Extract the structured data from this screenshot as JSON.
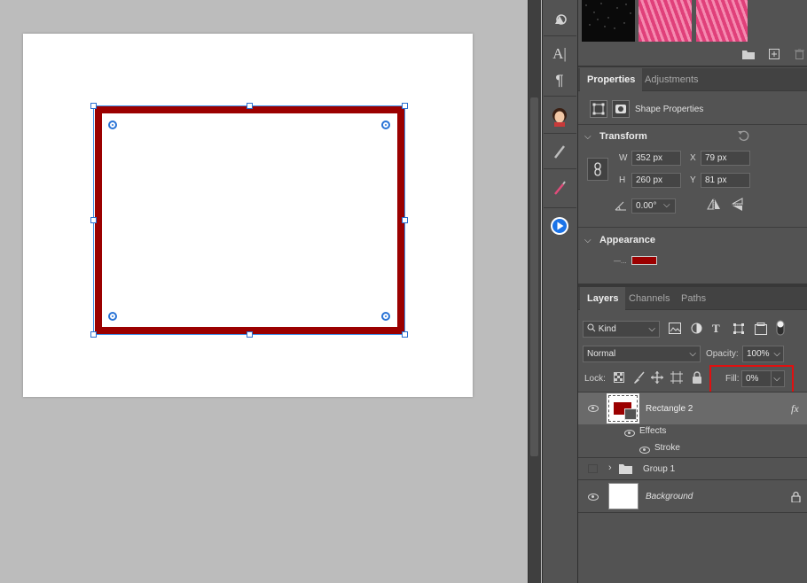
{
  "properties_panel": {
    "tabs": [
      "Properties",
      "Adjustments"
    ],
    "title": "Shape Properties",
    "transform": {
      "header": "Transform",
      "w_label": "W",
      "w_value": "352 px",
      "h_label": "H",
      "h_value": "260 px",
      "x_label": "X",
      "x_value": "79 px",
      "y_label": "Y",
      "y_value": "81 px",
      "angle_value": "0.00°"
    },
    "appearance": {
      "header": "Appearance",
      "stroke_prefix": "—...",
      "stroke_color": "#9b0000"
    }
  },
  "layers_panel": {
    "tabs": [
      "Layers",
      "Channels",
      "Paths"
    ],
    "filter_kind": "Kind",
    "blend_mode": "Normal",
    "opacity_label": "Opacity:",
    "opacity_value": "100%",
    "lock_label": "Lock:",
    "fill_label": "Fill:",
    "fill_value": "0%",
    "layers": [
      {
        "name": "Rectangle 2",
        "fx": "fx"
      },
      {
        "name": "Effects"
      },
      {
        "name": "Stroke"
      },
      {
        "name": "Group 1"
      },
      {
        "name": "Background"
      }
    ]
  },
  "colors": {
    "stroke": "#9b0000",
    "highlight": "#e01010",
    "selection": "#3d8ee6",
    "swatch_pink": "#e0407a"
  }
}
